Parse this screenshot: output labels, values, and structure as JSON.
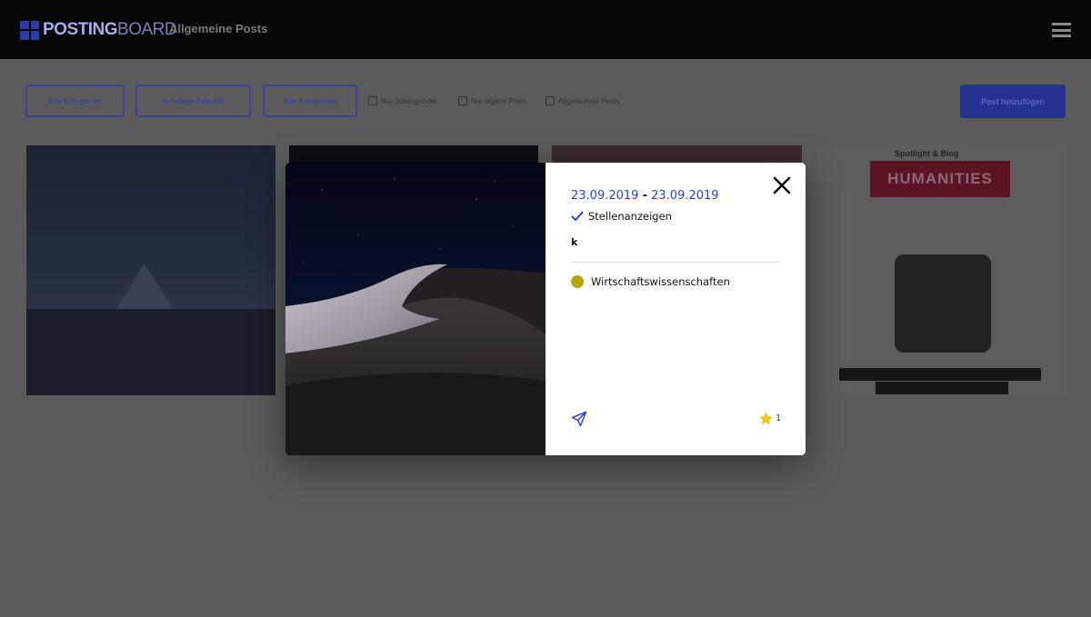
{
  "header": {
    "logo_bold": "POSTING",
    "logo_light": "BOARD",
    "title": "Allgemeine Posts"
  },
  "toolbar": {
    "filters": [
      "Alle Kategorien",
      "Beliebige Fakultät",
      "Alle Kategorien"
    ],
    "checkboxes": [
      "Nur Jobangebote",
      "Nur eigene Posts",
      "Abgelaufene Posts"
    ],
    "new_post": "Post hinzufügen"
  },
  "cards": {
    "card4_top": "Spotlight & Blog",
    "card4_band": "HUMANITIES"
  },
  "modal": {
    "start_date": "23.09.2019",
    "date_separator": "-",
    "end_date": "23.09.2019",
    "category": "Stellenanzeigen",
    "title": "k",
    "faculty": "Wirtschaftswissenschaften",
    "faculty_color": "#b5a40a",
    "accent_color": "#2e43cf",
    "star_count": "1",
    "icons": [
      "close-icon",
      "checkmark-icon",
      "send-icon",
      "star-icon"
    ]
  }
}
